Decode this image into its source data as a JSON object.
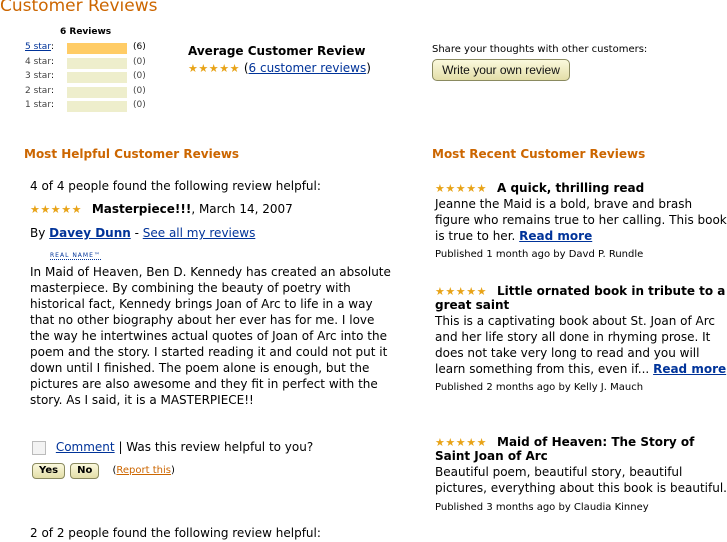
{
  "page_title": "Customer Reviews",
  "histogram": {
    "header": "6 Reviews",
    "rows": [
      {
        "label": "5 star",
        "count": "(6)",
        "fraction": 1.0
      },
      {
        "label": "4 star",
        "count": "(0)",
        "fraction": 0
      },
      {
        "label": "3 star",
        "count": "(0)",
        "fraction": 0
      },
      {
        "label": "2 star",
        "count": "(0)",
        "fraction": 0
      },
      {
        "label": "1 star",
        "count": "(0)",
        "fraction": 0
      }
    ]
  },
  "average": {
    "title": "Average Customer Review",
    "rating": 5,
    "reviews_link": "6 customer reviews",
    "paren_open": "(",
    "paren_close": ")"
  },
  "share": {
    "prompt": "Share your thoughts with other customers:",
    "button": "Write your own review"
  },
  "helpful": {
    "heading": "Most Helpful Customer Reviews",
    "review1": {
      "helpful_text": "4 of 4 people found the following review helpful:",
      "rating": 5,
      "title": "Masterpiece!!!",
      "date": ", March 14, 2007",
      "by": "By",
      "author": "Davey Dunn",
      "dash": " - ",
      "see_all": "See all my reviews",
      "badge": "REAL NAME™",
      "body": "In Maid of Heaven, Ben D. Kennedy has created an absolute masterpiece. By combining the beauty of poetry with historical fact, Kennedy brings Joan of Arc to life in a way that no other biography about her ever has for me. I love the way he intertwines actual quotes of Joan of Arc into the poem and the story. I started reading it and could not put it down until I finished. The poem alone is enough, but the pictures are also awesome and they fit in perfect with the story. As I said, it is a MASTERPIECE!!",
      "comment": "Comment",
      "sep": " | ",
      "helpful_q": "Was this review helpful to you?",
      "yes": "Yes",
      "no": "No",
      "report_open": "(",
      "report": "Report this",
      "report_close": ")"
    },
    "review2": {
      "helpful_text": "2 of 2 people found the following review helpful:"
    }
  },
  "recent": {
    "heading": "Most Recent Customer Reviews",
    "items": [
      {
        "rating": 5,
        "title": "A quick, thrilling read",
        "body": "Jeanne the Maid is a bold, brave and brash figure who remains true to her calling. This book is true to her.",
        "read_more": "Read more",
        "published": "Published 1 month ago by Davd P. Rundle"
      },
      {
        "rating": 5,
        "title": "Little ornated book in tribute to a great saint",
        "body": "This is a captivating book about St. Joan of Arc and her life story all done in rhyming prose. It does not take very long to read and you will learn something from this, even if...",
        "read_more": "Read more",
        "published": "Published 2 months ago by Kelly J. Mauch"
      },
      {
        "rating": 5,
        "title": "Maid of Heaven: The Story of Saint Joan of Arc",
        "body": "Beautiful poem, beautiful story, beautiful pictures, everything about this book is beautiful.",
        "read_more": "",
        "published": "Published 3 months ago by Claudia Kinney"
      }
    ]
  },
  "colors": {
    "heading": "#cc6600",
    "link": "#003399",
    "star": "#e8a317",
    "bar_fill": "#ffcc66",
    "bar_bg": "#eeeecc"
  },
  "icons": {
    "star": "star-icon",
    "checkbox": "comment-checkbox-icon"
  }
}
